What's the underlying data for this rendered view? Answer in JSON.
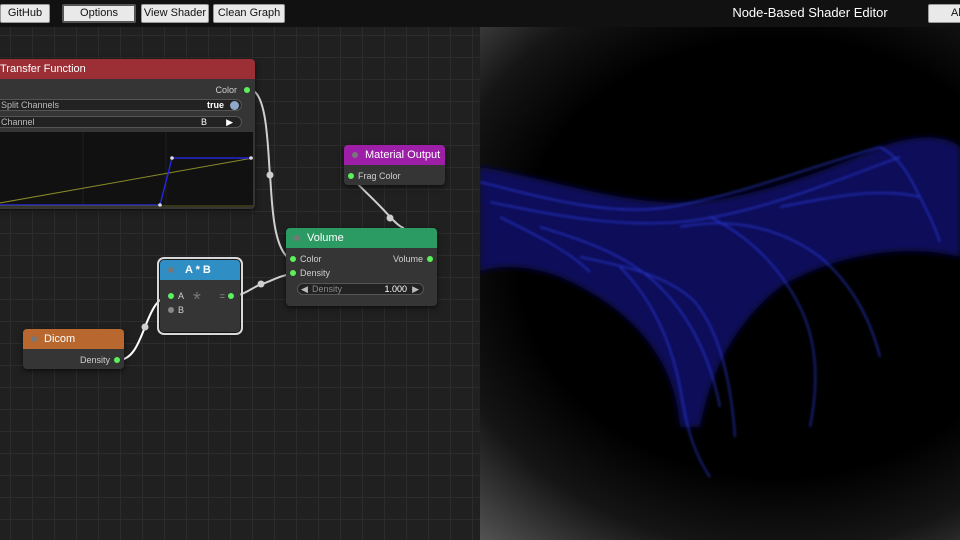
{
  "toolbar": {
    "github": "GitHub",
    "options": "Options",
    "view_shader": "View Shader",
    "clean_graph": "Clean Graph",
    "about_partial": "Al"
  },
  "app_title": "Node-Based Shader Editor",
  "nodes": {
    "transfer": {
      "title": "Transfer Function",
      "output": "Color",
      "split_label": "Split Channels",
      "split_value": "true",
      "channel_label": "Channel",
      "channel_value": "B",
      "channel_arrow": "▶"
    },
    "material": {
      "title": "Material Output",
      "input": "Frag Color"
    },
    "volume": {
      "title": "Volume",
      "input_color": "Color",
      "input_density": "Density",
      "output": "Volume",
      "density_label": "Density",
      "density_value": "1.000",
      "left_arrow": "◀",
      "right_arrow": "▶"
    },
    "multiply": {
      "title": "A * B",
      "input_a": "A",
      "input_b": "B",
      "op_symbol": "*",
      "output": "="
    },
    "dicom": {
      "title": "Dicom",
      "output": "Density"
    }
  },
  "colors": {
    "transfer_header": "#9b2f35",
    "material_header": "#9d1fa7",
    "volume_header": "#2c9a63",
    "multiply_header": "#2f8ec4",
    "dicom_header": "#b8672e",
    "socket": "#5cf05c",
    "wire": "#cfcfcf"
  }
}
